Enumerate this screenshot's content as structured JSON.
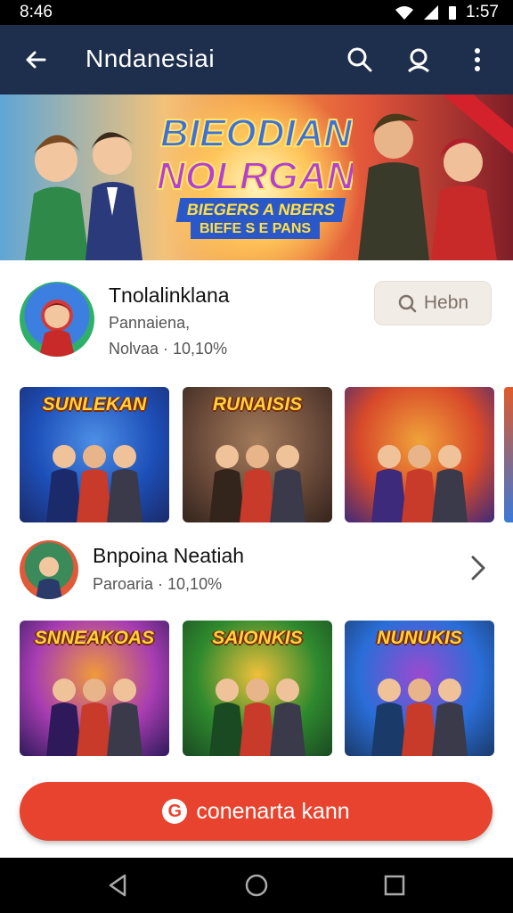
{
  "status_bar": {
    "time": "8:46",
    "right_time": "1:57"
  },
  "app_bar": {
    "title": "Nndanesiai"
  },
  "banner": {
    "title_line1": "BIEODIAN",
    "title_line2": "NOLRGAN",
    "subtitle": "BIEGERS A NBERS",
    "tagline": "BIEFE S E PANS"
  },
  "profile_card": {
    "name": "Tnolalinklana",
    "line1": "Pannaiena,",
    "line2": "Nolvaa · 10,10%",
    "button_label": "Hebn"
  },
  "row1_tiles": [
    {
      "logo": "SUNLEKAN",
      "palette": [
        "#1d4fb8",
        "#4d8fe6",
        "#1a2a6a"
      ]
    },
    {
      "logo": "RUNAISIS",
      "palette": [
        "#6a4a3a",
        "#a37b5a",
        "#33241c"
      ]
    },
    {
      "logo": "",
      "palette": [
        "#d8492a",
        "#f0a33a",
        "#3e2a7a"
      ]
    }
  ],
  "section2": {
    "name": "Bnpoina Neatiah",
    "meta": "Paroaria · 10,10%"
  },
  "row2_tiles": [
    {
      "logo": "SNNEAKOAS",
      "palette": [
        "#a83db2",
        "#f09a3a",
        "#2e1a5a"
      ]
    },
    {
      "logo": "SAIONKIS",
      "palette": [
        "#2f8a2e",
        "#f0c03a",
        "#1a4a22"
      ]
    },
    {
      "logo": "NUNUKIS",
      "palette": [
        "#2a6ed8",
        "#9a4ad0",
        "#1a3a6a"
      ]
    }
  ],
  "cta": {
    "label": "conenarta kann",
    "icon": "G"
  },
  "colors": {
    "app_bar": "#1e2f4d",
    "cta": "#e8432e"
  },
  "icons": [
    "back-arrow-icon",
    "search-icon",
    "account-icon",
    "more-vert-icon",
    "chevron-right-icon",
    "search-small-icon",
    "nav-back-icon",
    "nav-home-icon",
    "nav-recents-icon"
  ]
}
